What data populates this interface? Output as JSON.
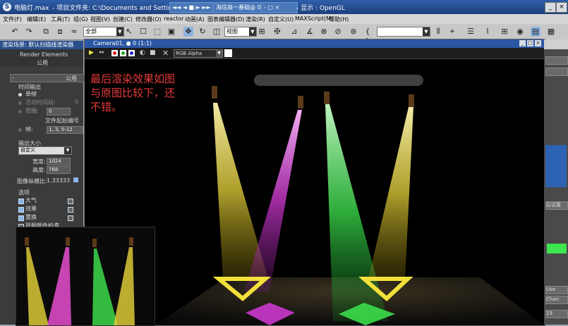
{
  "titlebar": {
    "app_title": "电脑灯.max",
    "project_path": "- 项目文件夹: C:\\Documents and Settings\\",
    "task_label": "海信商一基础@ 05:187",
    "display_label": "- 显示 : OpenGL"
  },
  "menu": [
    "文件(F)",
    "编辑(E)",
    "工具(T)",
    "组(G)",
    "视图(V)",
    "创建(C)",
    "修改器(O)",
    "reactor",
    "动画(A)",
    "图表编辑器(D)",
    "渲染(R)",
    "自定义(U)",
    "MAXScript(M)",
    "帮助(H)"
  ],
  "toolbar": {
    "selection_filter": "全部",
    "view_select": "视图",
    "named_set": ""
  },
  "left_panel": {
    "title": "渲染场景: 默认扫描线渲染器",
    "tab_render_elements": "Render Elements",
    "tab_common": "公用",
    "section_common": "公用",
    "time_output_label": "时间输出",
    "single_frame": "单帧",
    "active_time": "活动时间段:",
    "active_time_value": "0",
    "range": "范围:",
    "range_from": "0",
    "file_number_base": "文件起始编号",
    "frames": "帧:",
    "frames_value": "1, 3, 5-12",
    "output_size_label": "输出大小",
    "custom": "自定义",
    "width_label": "宽度:",
    "width_value": "1024",
    "height_label": "高度:",
    "height_value": "768",
    "aspect_label": "图像纵横比:",
    "aspect_value": "1.33333",
    "options_label": "选项",
    "opt_atmosphere": "大气",
    "opt_effects": "效果",
    "opt_displacement": "置换",
    "opt_video_color": "视频颜色检查"
  },
  "viewport": {
    "title": "Camera01, ● 0 (1:1)",
    "channel": "RGB Alpha",
    "caption_lines": [
      "最后渲染效果如图",
      "与原图比较下，还",
      "不错。"
    ]
  },
  "right_panel": {
    "items": [
      "后设置",
      "Use",
      "Chan",
      "19"
    ]
  },
  "colors": {
    "caption": "#e53a3a",
    "beam_yellow": "#e8d43a",
    "beam_magenta": "#d53ad8",
    "beam_green": "#3ee64f",
    "titlebar": "#2f5fa8"
  }
}
